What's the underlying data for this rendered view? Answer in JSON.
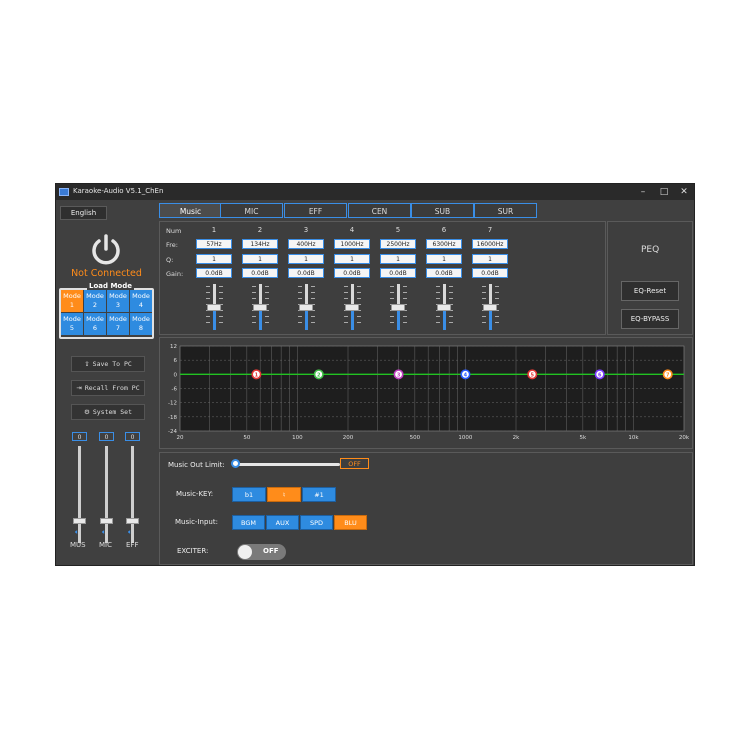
{
  "window": {
    "title": "Karaoke-Audio V5.1_ChEn",
    "minimize": "–",
    "maximize": "□",
    "close": "✕"
  },
  "sidebar": {
    "language": "English",
    "connection_status": "Not Connected",
    "load_mode_title": "Load Mode",
    "modes": [
      {
        "line1": "Mode",
        "line2": "1"
      },
      {
        "line1": "Mode",
        "line2": "2"
      },
      {
        "line1": "Mode",
        "line2": "3"
      },
      {
        "line1": "Mode",
        "line2": "4"
      },
      {
        "line1": "Mode",
        "line2": "5"
      },
      {
        "line1": "Mode",
        "line2": "6"
      },
      {
        "line1": "Mode",
        "line2": "7"
      },
      {
        "line1": "Mode",
        "line2": "8"
      }
    ],
    "active_mode": 1,
    "save_label": "Save To PC",
    "recall_label": "Recall From PC",
    "system_label": "System Set",
    "channels": [
      {
        "name": "MUS",
        "value": "0"
      },
      {
        "name": "MIC",
        "value": "0"
      },
      {
        "name": "EFF",
        "value": "0"
      }
    ]
  },
  "tabs": [
    "Music",
    "MIC",
    "EFF",
    "CEN",
    "SUB",
    "SUR"
  ],
  "active_tab": "Music",
  "eq": {
    "row_labels": {
      "num": "Num",
      "freq": "Fre:",
      "q": "Q:",
      "gain": "Gain:"
    },
    "bands": [
      {
        "num": "1",
        "freq": "57Hz",
        "q": "1",
        "gain": "0.0dB"
      },
      {
        "num": "2",
        "freq": "134Hz",
        "q": "1",
        "gain": "0.0dB"
      },
      {
        "num": "3",
        "freq": "400Hz",
        "q": "1",
        "gain": "0.0dB"
      },
      {
        "num": "4",
        "freq": "1000Hz",
        "q": "1",
        "gain": "0.0dB"
      },
      {
        "num": "5",
        "freq": "2500Hz",
        "q": "1",
        "gain": "0.0dB"
      },
      {
        "num": "6",
        "freq": "6300Hz",
        "q": "1",
        "gain": "0.0dB"
      },
      {
        "num": "7",
        "freq": "16000Hz",
        "q": "1",
        "gain": "0.0dB"
      }
    ]
  },
  "peq": {
    "title": "PEQ",
    "reset_label": "EQ-Reset",
    "bypass_label": "EQ-BYPASS"
  },
  "graph": {
    "y_ticks": [
      "12",
      "6",
      "0",
      "-6",
      "-12",
      "-18",
      "-24"
    ],
    "x_ticks": [
      "20",
      "50",
      "100",
      "200",
      "500",
      "1000",
      "2k",
      "5k",
      "10k",
      "20k"
    ],
    "points": [
      {
        "label": "1",
        "color": "#e53935"
      },
      {
        "label": "2",
        "color": "#43c04a"
      },
      {
        "label": "3",
        "color": "#c040c0"
      },
      {
        "label": "4",
        "color": "#2a5cff"
      },
      {
        "label": "5",
        "color": "#e53935"
      },
      {
        "label": "6",
        "color": "#7a3cff"
      },
      {
        "label": "7",
        "color": "#ff8c1a"
      }
    ],
    "line_color": "#22c322"
  },
  "controls": {
    "music_out_limit_label": "Music Out Limit:",
    "music_out_limit_state": "OFF",
    "music_key_label": "Music-KEY:",
    "keys": [
      "b1",
      "♮",
      "#1"
    ],
    "active_key": 1,
    "music_input_label": "Music-Input:",
    "inputs": [
      "BGM",
      "AUX",
      "SPD",
      "BLU"
    ],
    "active_input": 3,
    "exciter_label": "EXCITER:",
    "exciter_state": "OFF"
  }
}
